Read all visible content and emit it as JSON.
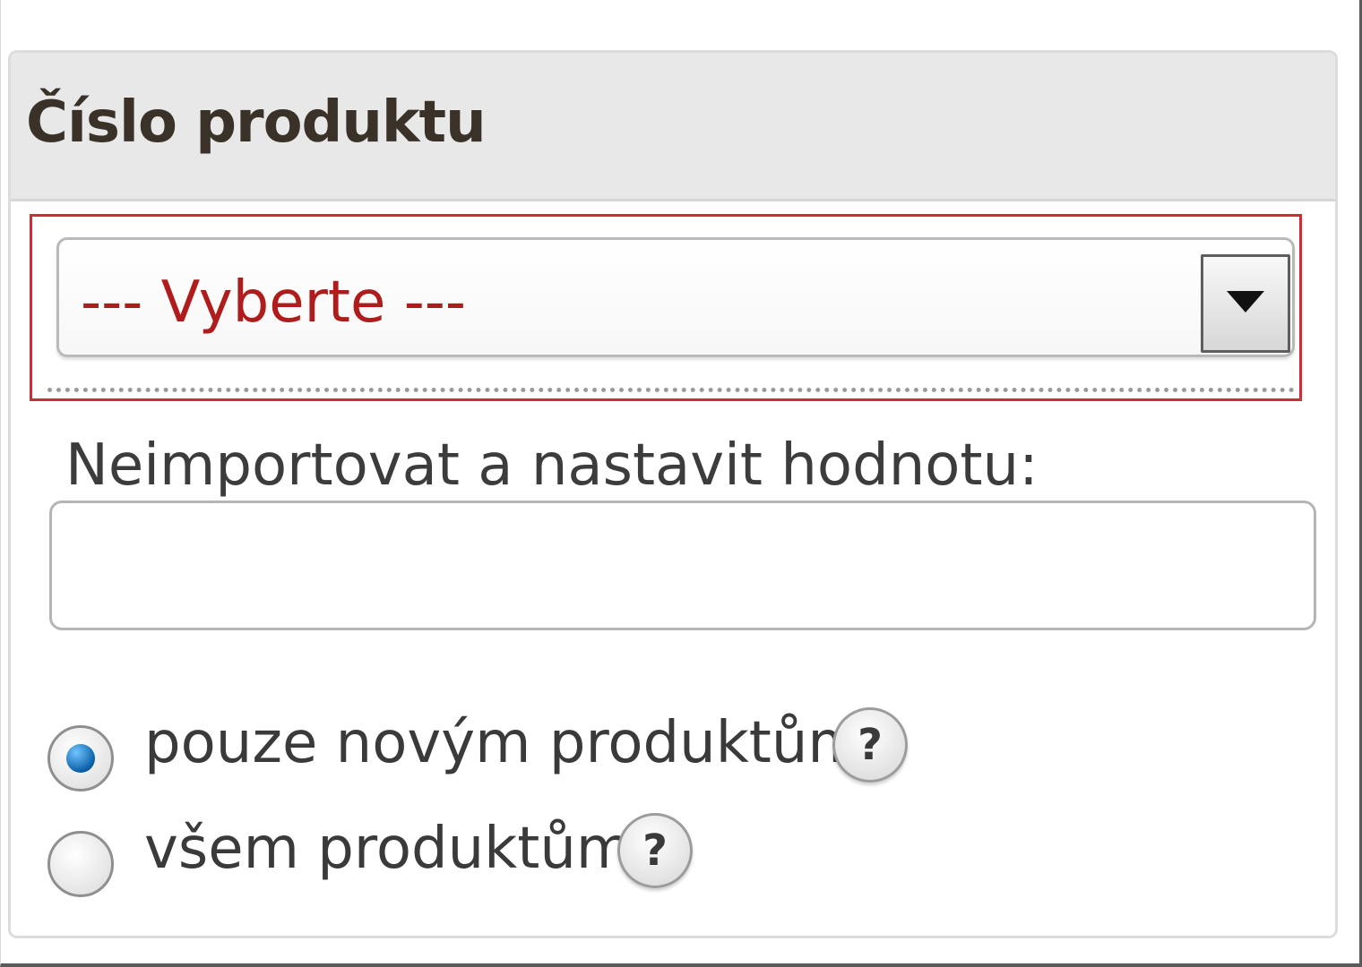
{
  "panel": {
    "title": "Číslo produktu"
  },
  "select": {
    "value": "--- Vyberte ---",
    "arrow_icon": "caret-down-icon",
    "value_color": "#b01c1c"
  },
  "highlight": {
    "color": "#d42a35"
  },
  "field": {
    "label": "Neimportovat a nastavit hodnotu:",
    "value": "",
    "placeholder": ""
  },
  "options": [
    {
      "label": "pouze novým produktům.",
      "checked": true,
      "help_icon": "help-icon",
      "help_text": "?"
    },
    {
      "label": "všem produktům.",
      "checked": false,
      "help_icon": "help-icon",
      "help_text": "?"
    }
  ]
}
